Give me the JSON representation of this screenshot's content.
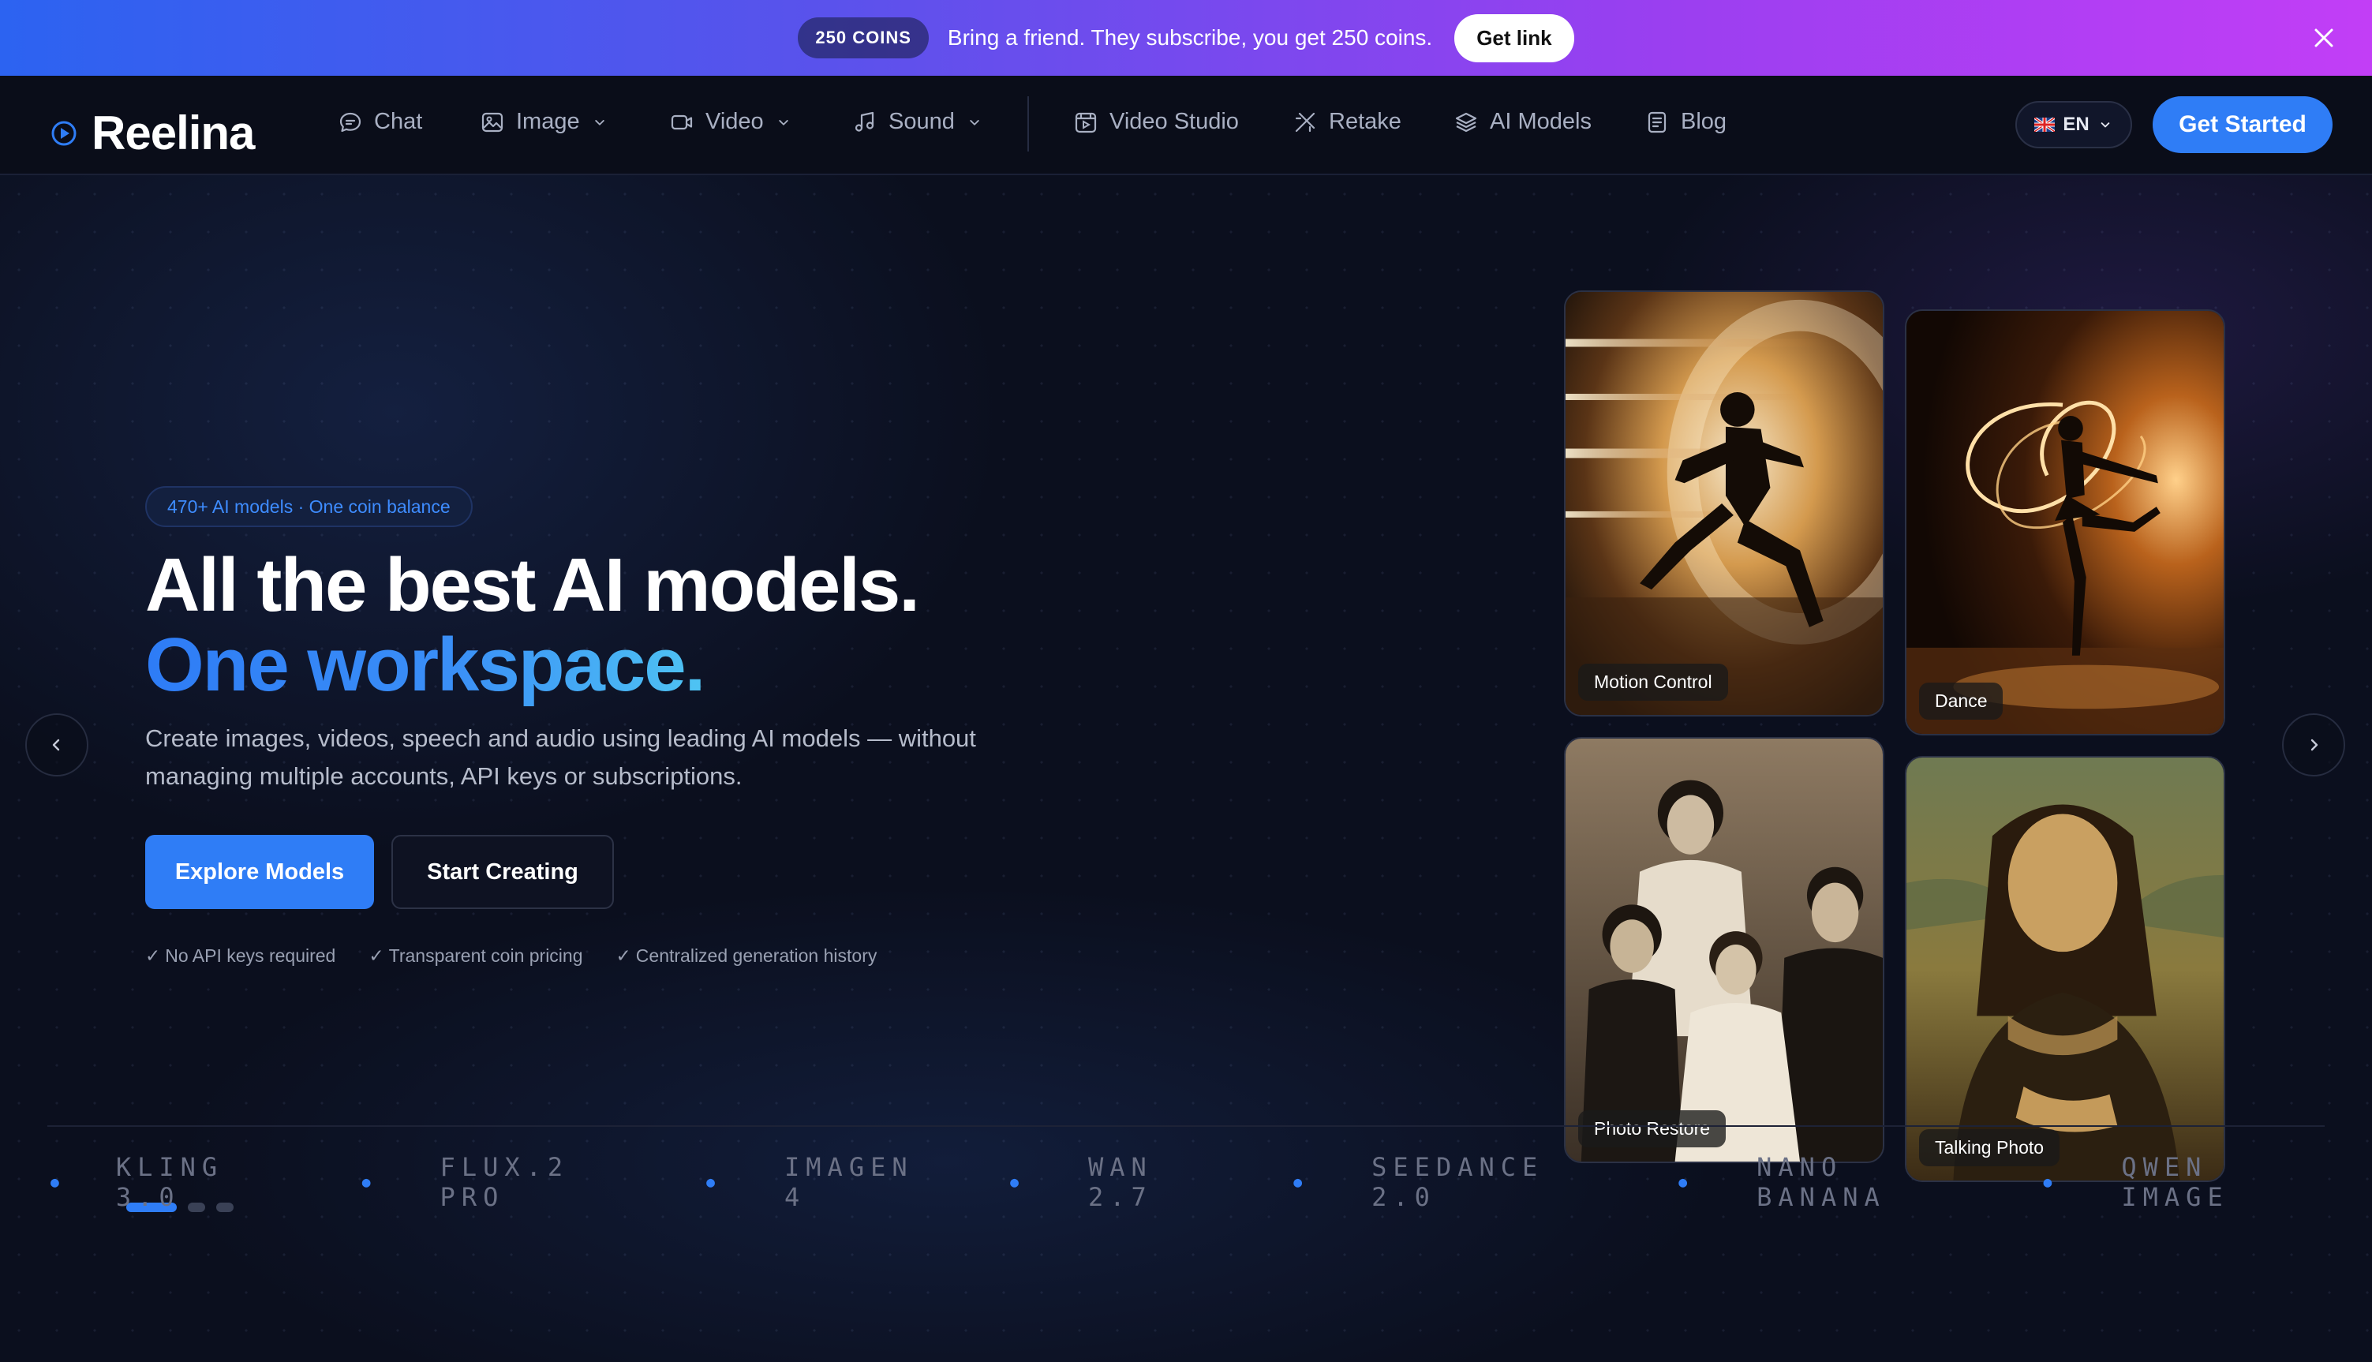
{
  "promo": {
    "badge": "250 COINS",
    "text": "Bring a friend. They subscribe, you get 250 coins.",
    "cta": "Get link",
    "close_icon": "close-icon"
  },
  "nav": {
    "brand": "Reelina",
    "items": [
      {
        "label": "Chat",
        "icon": "chat-icon"
      },
      {
        "label": "Image",
        "icon": "image-icon",
        "dropdown": true
      },
      {
        "label": "Video",
        "icon": "video-icon",
        "dropdown": true
      },
      {
        "label": "Sound",
        "icon": "music-icon",
        "dropdown": true
      },
      {
        "label": "Video Studio",
        "icon": "studio-icon"
      },
      {
        "label": "Retake",
        "icon": "retake-icon"
      },
      {
        "label": "AI Models",
        "icon": "layers-icon"
      },
      {
        "label": "Blog",
        "icon": "document-icon"
      }
    ],
    "language": "EN",
    "cta": "Get Started"
  },
  "hero": {
    "pill": "470+ AI models · One coin balance",
    "title_line1": "All the best AI models.",
    "title_line2": "One workspace.",
    "subtitle": "Create images, videos, speech and audio using leading AI models — without managing multiple accounts, API keys or subscriptions.",
    "primary_cta": "Explore Models",
    "secondary_cta": "Start Creating",
    "checks": [
      "No API keys required",
      "Transparent coin pricing",
      "Centralized generation history"
    ],
    "slides_total": 3,
    "slide_active": 1
  },
  "cards": [
    {
      "label": "Motion Control"
    },
    {
      "label": "Dance"
    },
    {
      "label": "Photo Restore"
    },
    {
      "label": "Talking Photo"
    }
  ],
  "ticker": [
    "KLING 3.0",
    "FLUX.2 PRO",
    "IMAGEN 4",
    "WAN 2.7",
    "SEEDANCE 2.0",
    "NANO BANANA",
    "QWEN IMAGE"
  ],
  "colors": {
    "accent": "#2f7df6",
    "background": "#0b0f1e",
    "promo_gradient_start": "#2c63f1",
    "promo_gradient_end": "#c23ef6"
  }
}
